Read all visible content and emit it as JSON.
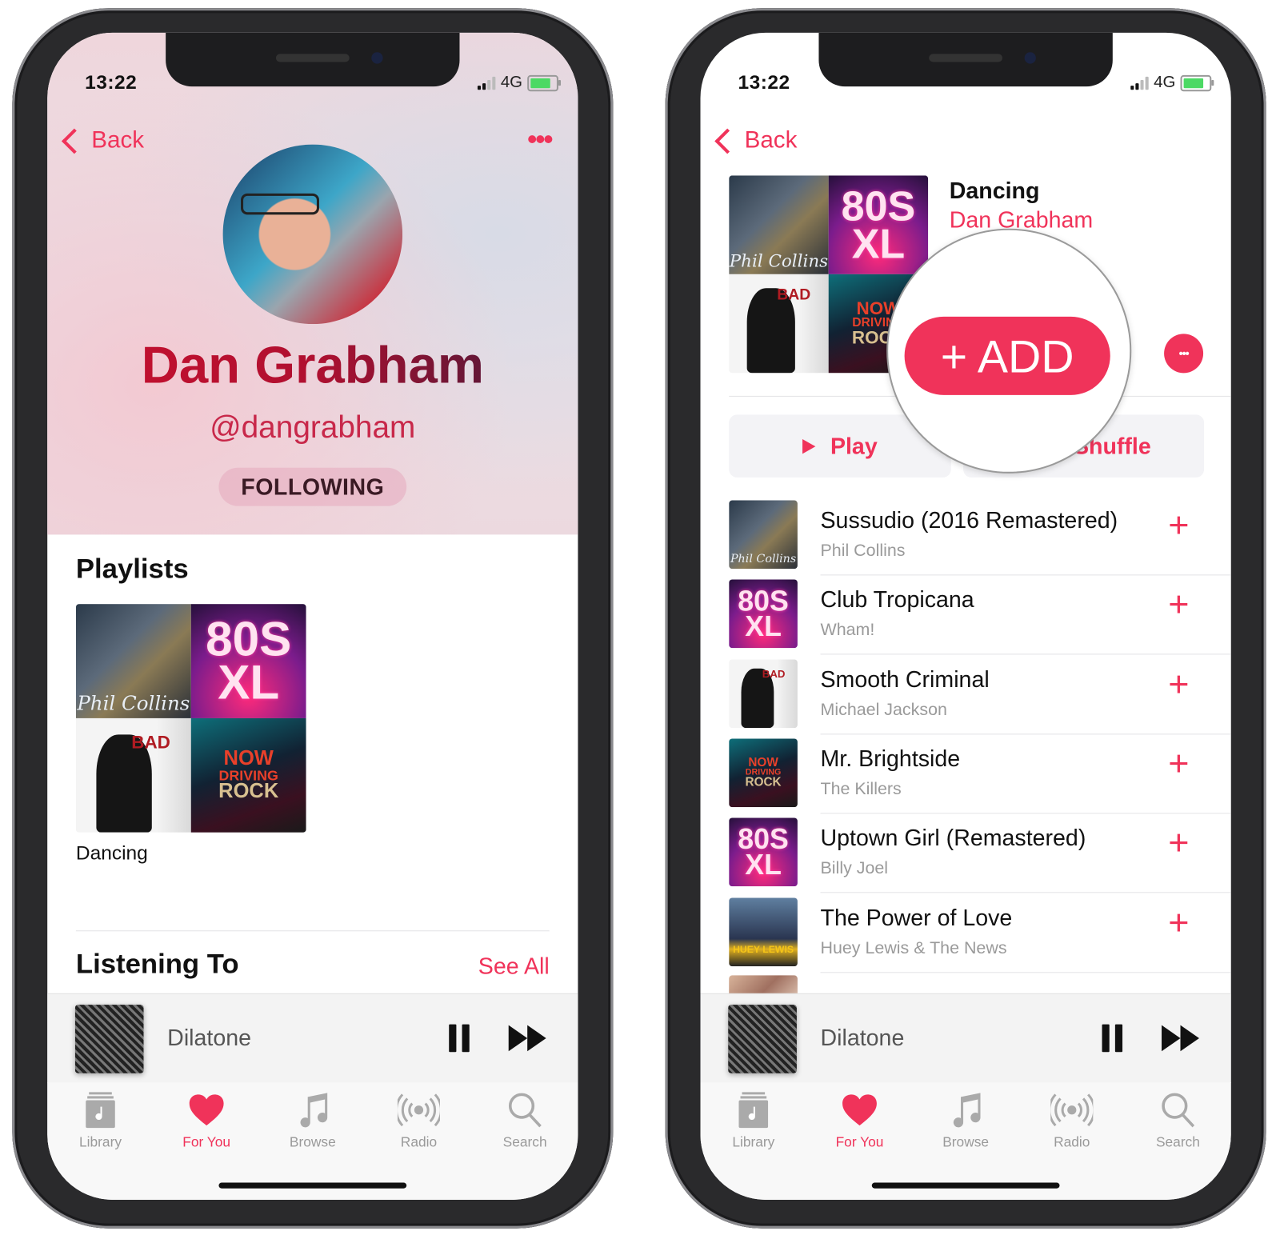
{
  "colors": {
    "accent": "#f0335a",
    "tab_inactive": "#9a9a9a"
  },
  "status": {
    "time": "13:22",
    "network": "4G",
    "icons": [
      "signal-icon",
      "battery-charging-icon"
    ]
  },
  "profile_screen": {
    "back_label": "Back",
    "more_icon": "ellipsis-icon",
    "name": "Dan Grabham",
    "handle": "@dangrabham",
    "follow_label": "FOLLOWING",
    "playlists_heading": "Playlists",
    "playlist": {
      "title": "Dancing"
    },
    "listening_heading": "Listening To",
    "see_all_label": "See All"
  },
  "playlist_screen": {
    "back_label": "Back",
    "title": "Dancing",
    "curator": "Dan Grabham",
    "add_label": "+ ADD",
    "play_label": "Play",
    "shuffle_label": "Shuffle",
    "tracks": [
      {
        "title": "Sussudio (2016 Remastered)",
        "artist": "Phil Collins",
        "cover": "phil"
      },
      {
        "title": "Club Tropicana",
        "artist": "Wham!",
        "cover": "80s"
      },
      {
        "title": "Smooth Criminal",
        "artist": "Michael Jackson",
        "cover": "bad"
      },
      {
        "title": "Mr. Brightside",
        "artist": "The Killers",
        "cover": "now"
      },
      {
        "title": "Uptown Girl (Remastered)",
        "artist": "Billy Joel",
        "cover": "80s"
      },
      {
        "title": "The Power of Love",
        "artist": "Huey Lewis & The News",
        "cover": "huey"
      }
    ]
  },
  "cover_lettering": {
    "phil": "Phil Collins",
    "eighties_1": "80S",
    "eighties_2": "XL",
    "bad": "BAD",
    "now_1": "NOW",
    "now_2": "DRIVING",
    "now_3": "ROCK",
    "huey": "HUEY LEWIS"
  },
  "now_playing": {
    "title": "Dilatone"
  },
  "tabs": [
    {
      "label": "Library",
      "icon": "library-icon",
      "active": false
    },
    {
      "label": "For You",
      "icon": "heart-icon",
      "active": true
    },
    {
      "label": "Browse",
      "icon": "music-note-icon",
      "active": false
    },
    {
      "label": "Radio",
      "icon": "radio-icon",
      "active": false
    },
    {
      "label": "Search",
      "icon": "search-icon",
      "active": false
    }
  ]
}
